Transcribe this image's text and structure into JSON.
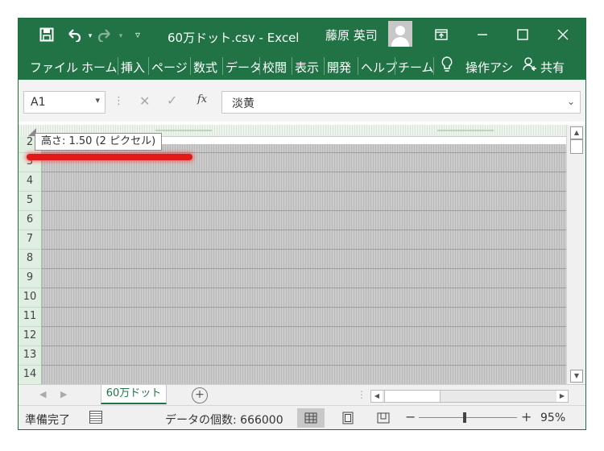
{
  "app": {
    "title": "60万ドット.csv  -  Excel",
    "user": "藤原 英司",
    "accent": "#217346"
  },
  "quick_access": {
    "icons": [
      "save-icon",
      "undo-icon",
      "redo-icon",
      "customize-qat-icon"
    ]
  },
  "ribbon": {
    "tabs": [
      "ファイル",
      "ホーム",
      "挿入",
      "ページ",
      "数式",
      "データ",
      "校閲",
      "表示",
      "開発",
      "ヘルプ",
      "チーム"
    ],
    "tell_me": "操作アシ",
    "share": "共有"
  },
  "formula_bar": {
    "name_box": "A1",
    "formula": "淡黄"
  },
  "grid": {
    "row_numbers": [
      "2",
      "3",
      "4",
      "5",
      "6",
      "7",
      "8",
      "9",
      "10",
      "11",
      "12",
      "13",
      "14"
    ],
    "tooltip": "高さ: 1.50 (2 ピクセル)"
  },
  "sheets": {
    "active": "60万ドット"
  },
  "status": {
    "ready": "準備完了",
    "count": "データの個数: 666000",
    "zoom_minus": "−",
    "zoom_plus": "+",
    "zoom": "95%",
    "zoom_percent": 95
  }
}
